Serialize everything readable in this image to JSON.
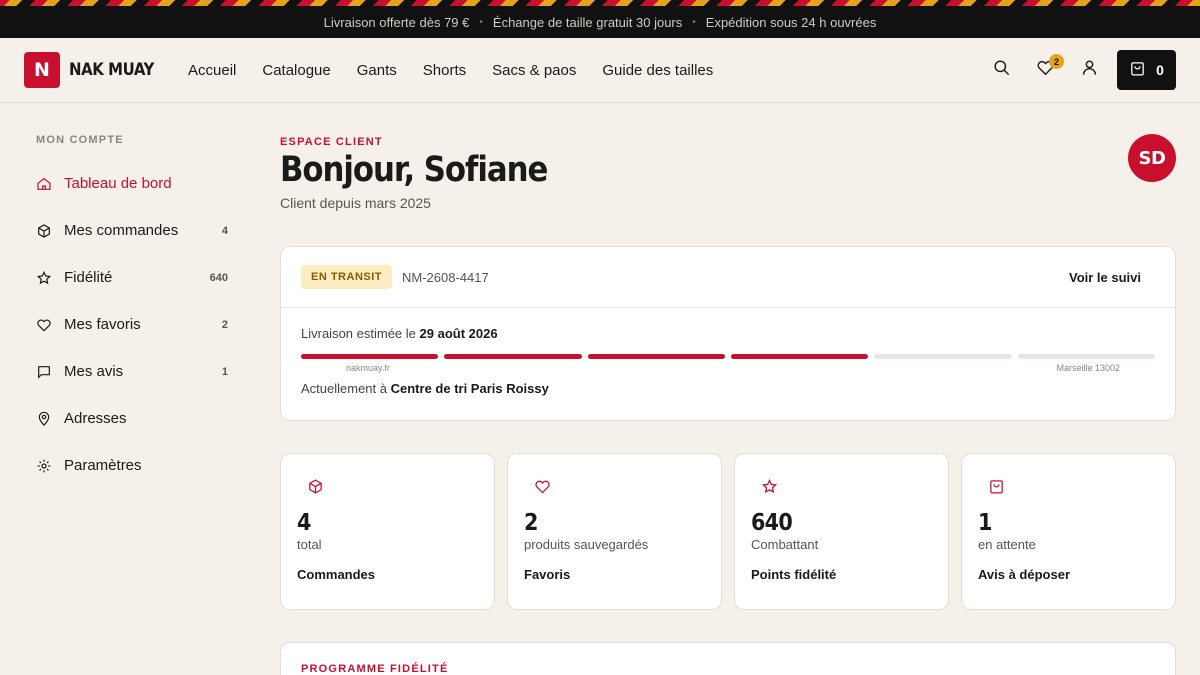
{
  "announcement": {
    "items": [
      "Livraison offerte dès 79 €",
      "Échange de taille gratuit 30 jours",
      "Expédition sous 24 h ouvrées"
    ]
  },
  "brand": {
    "mark": "N",
    "name": "NAK MUAY",
    "accent": "#c8102e",
    "gold": "#e3a31b"
  },
  "nav": {
    "items": [
      "Accueil",
      "Catalogue",
      "Gants",
      "Shorts",
      "Sacs & paos",
      "Guide des tailles"
    ]
  },
  "header": {
    "icons": [
      "search-icon",
      "heart-icon",
      "user-icon",
      "bag-icon"
    ],
    "favorites_count": "2",
    "cart_count": "0"
  },
  "sidebar": {
    "title": "MON COMPTE",
    "items": [
      {
        "label": "Tableau de bord",
        "count": "",
        "icon": "home-icon",
        "active": true
      },
      {
        "label": "Mes commandes",
        "count": "4",
        "icon": "box-icon"
      },
      {
        "label": "Fidélité",
        "count": "640",
        "icon": "star-icon"
      },
      {
        "label": "Mes favoris",
        "count": "2",
        "icon": "heart-icon"
      },
      {
        "label": "Mes avis",
        "count": "1",
        "icon": "message-icon"
      },
      {
        "label": "Adresses",
        "count": "",
        "icon": "pin-icon"
      },
      {
        "label": "Paramètres",
        "count": "",
        "icon": "gear-icon"
      }
    ]
  },
  "main": {
    "eyebrow": "ESPACE CLIENT",
    "greeting": "Bonjour, Sofiane",
    "since": "Client depuis mars 2025",
    "avatar": "SD"
  },
  "order": {
    "status": "EN TRANSIT",
    "number": "NM-2608-4417",
    "track_label": "Voir le suivi",
    "eta_prefix": "Livraison estimée le",
    "eta_date": "29 août 2026",
    "progress_done": 4,
    "progress_total": 6,
    "from": "nakmuay.fr",
    "to": "Marseille 13002",
    "current_prefix": "Actuellement à",
    "current_location": "Centre de tri Paris Roissy"
  },
  "stats": [
    {
      "icon": "box-icon",
      "value": "4",
      "sub": "total",
      "label": "Commandes"
    },
    {
      "icon": "heart-icon",
      "value": "2",
      "sub": "produits sauvegardés",
      "label": "Favoris"
    },
    {
      "icon": "star-icon",
      "value": "640",
      "sub": "Combattant",
      "label": "Points fidélité"
    },
    {
      "icon": "bag-icon",
      "value": "1",
      "sub": "en attente",
      "label": "Avis à déposer"
    }
  ],
  "loyalty": {
    "title": "PROGRAMME FIDÉLITÉ"
  }
}
